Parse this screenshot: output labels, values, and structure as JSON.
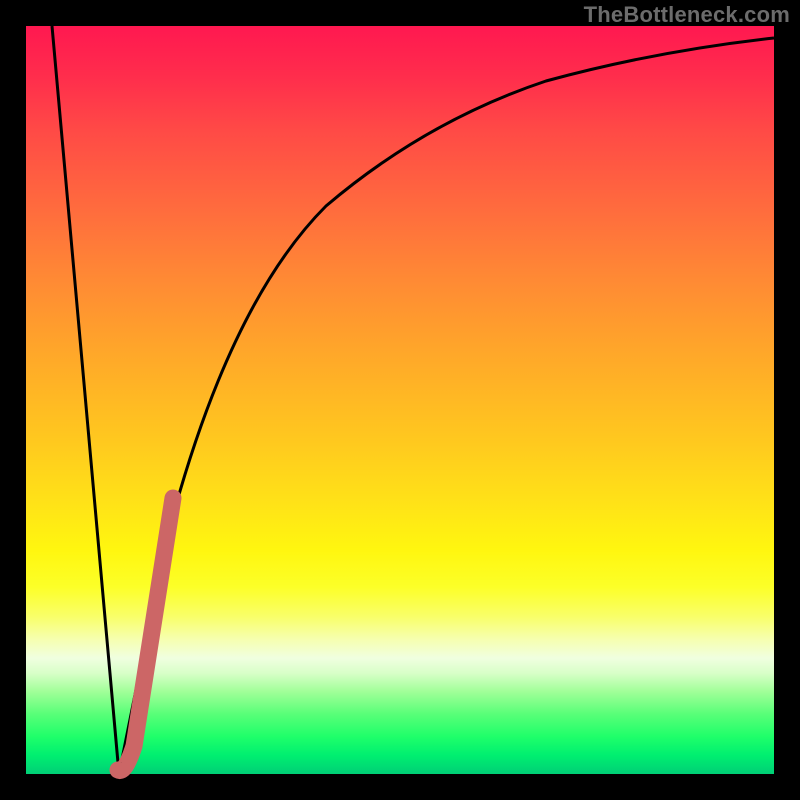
{
  "watermark": "TheBottleneck.com",
  "chart_data": {
    "type": "line",
    "title": "",
    "xlabel": "",
    "ylabel": "",
    "xlim": [
      0,
      100
    ],
    "ylim": [
      0,
      100
    ],
    "grid": false,
    "series": [
      {
        "name": "black-curve",
        "color": "#000000",
        "x": [
          3.5,
          12.5,
          18,
          25,
          32,
          40,
          48,
          56,
          65,
          75,
          85,
          95,
          100
        ],
        "y": [
          100,
          0,
          30,
          58,
          73,
          82,
          87.5,
          91,
          93.5,
          95.5,
          97,
          98,
          98.5
        ]
      },
      {
        "name": "pink-overlay",
        "color": "#cc6666",
        "x": [
          12.5,
          13.5,
          14.5,
          17,
          19.5
        ],
        "y": [
          0,
          0,
          4,
          21,
          37
        ]
      }
    ],
    "gradient": {
      "top": "#ff1850",
      "mid": "#ffe317",
      "bottom": "#00cf76"
    }
  }
}
